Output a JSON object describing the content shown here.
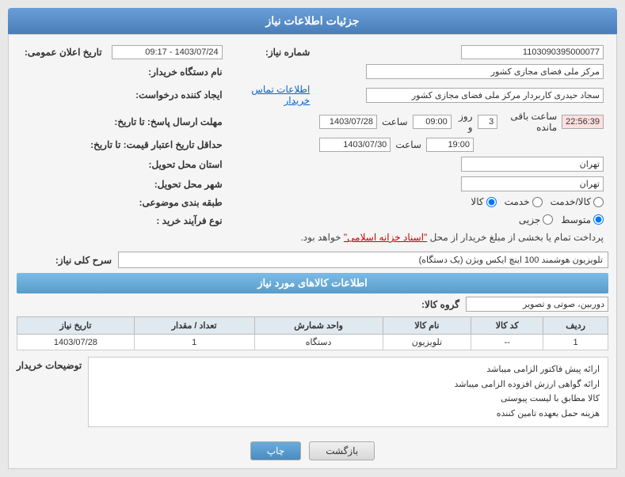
{
  "header": {
    "title": "جزئیات اطلاعات نیاز"
  },
  "fields": {
    "shomara_niaz_label": "شماره نیاز:",
    "shomara_niaz_value": "1103090395000077",
    "nam_dastgah_label": "نام دستگاه خریدار:",
    "nam_dastgah_value": "مرکز ملی فضای مجازی کشور",
    "ijad_konande_label": "ایجاد کننده درخواست:",
    "ijad_konande_value": "سجاد حیدری کاربردار مرکز ملی فضای مجازی کشور",
    "ettelaat_tamas_link": "اطلاعات تماس خریدار",
    "mohlat_ersal_label": "مهلت ارسال پاسخ: تا تاریخ:",
    "mohlat_date": "1403/07/28",
    "mohlat_time": "09:00",
    "mohlat_roz_label": "روز و",
    "mohlat_roz_value": "3",
    "mohlat_saat_label": "ساعت",
    "mohlat_saat_value": "22:56:39",
    "mohlat_baqi_label": "ساعت باقی مانده",
    "tarikh_label": "تاریخ اعلان عمومی:",
    "tarikh_value": "1403/07/24 - 09:17",
    "jadaval_label": "حداقل تاریخ اعتبار قیمت: تا تاریخ:",
    "jadaval_date": "1403/07/30",
    "jadaval_time": "19:00",
    "ostan_label": "استان محل تحویل:",
    "ostan_value": "تهران",
    "shahr_label": "شهر محل تحویل:",
    "shahr_value": "تهران",
    "tabaqe_label": "طبقه بندی موضوعی:",
    "radios_tabaqe": [
      "کالا",
      "خدمت",
      "کالا/خدمت"
    ],
    "selected_tabaqe": "کالا",
    "noe_farayand_label": "نوع فرآیند خرید :",
    "radios_farayand": [
      "جزیی",
      "متوسط"
    ],
    "selected_farayand": "متوسط",
    "notice": "پرداخت تمام یا بخشی از مبلغ خریدار از محل",
    "notice_link": "\"اسناد خزانه اسلامی\"",
    "notice_end": "خواهد بود.",
    "sarh_koli_label": "سرح کلی نیاز:",
    "sarh_koli_value": "تلویزیون هوشمند 100 اینچ ایکس ویژن (یک دستگاه)"
  },
  "goods_section": {
    "title": "اطلاعات کالاهای مورد نیاز",
    "group_label": "گروه کالا:",
    "group_value": "دوربین، صوتی و تصویر",
    "columns": [
      "ردیف",
      "کد کالا",
      "نام کالا",
      "واحد شمارش",
      "تعداد / مقدار",
      "تاریخ نیاز"
    ],
    "rows": [
      {
        "radif": "1",
        "kod": "--",
        "nam": "تلویزیون",
        "vahed": "دستگاه",
        "tedad": "1",
        "tarikh": "1403/07/28"
      }
    ]
  },
  "description": {
    "title": "توضیحات خریدار",
    "lines": [
      "ارائه پیش فاکتور الزامی میباشد",
      "ارائه گواهی ارزش افزوده الزامی میباشد",
      "کالا مطابق با لیست پیوستی",
      "هزینه حمل بعهده تامین کننده"
    ]
  },
  "buttons": {
    "back": "بازگشت",
    "print": "چاپ"
  }
}
